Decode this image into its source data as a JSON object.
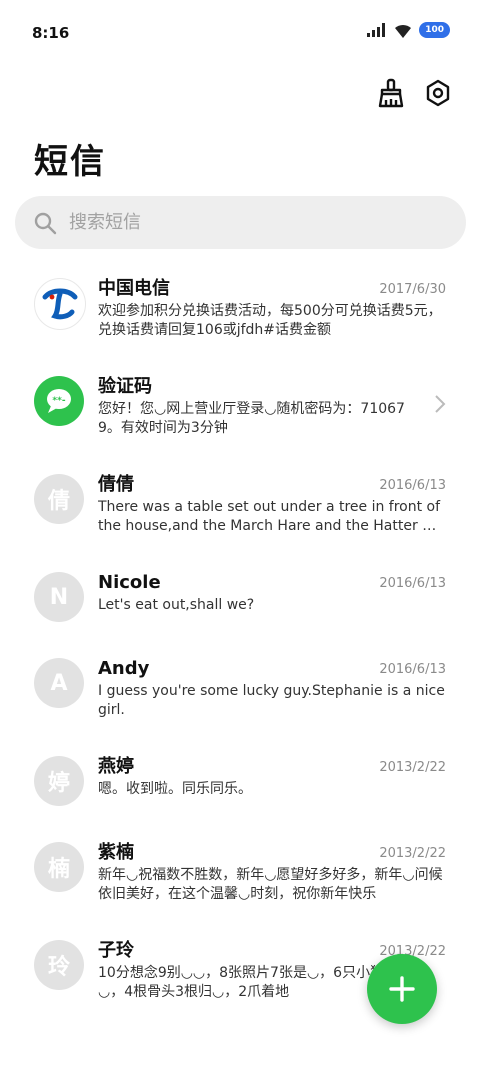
{
  "status": {
    "time": "8:16",
    "battery": "100"
  },
  "header": {
    "title": "短信"
  },
  "search": {
    "placeholder": "搜索短信"
  },
  "colors": {
    "accent": "#2ec24d",
    "battery": "#2f6fe8",
    "avatar_default": "#e2e2e2"
  },
  "conversations": [
    {
      "name": "中国电信",
      "date": "2017/6/30",
      "avatar": "china-telecom-logo",
      "preview": "欢迎参加积分兑换话费活动，每500分可兑换话费5元，兑换话费请回复106或jfdh#话费金额"
    },
    {
      "name": "验证码",
      "date": "",
      "avatar": "message-icon",
      "preview": "您好！您◡网上营业厅登录◡随机密码为：710679。有效时间为3分钟"
    },
    {
      "name": "倩倩",
      "date": "2016/6/13",
      "avatar": "倩",
      "preview": "There was a table set out under a tree in front of the house,and the March Hare and the Hatter were having tea at it"
    },
    {
      "name": "Nicole",
      "date": "2016/6/13",
      "avatar": "N",
      "preview": "Let's eat out,shall we?"
    },
    {
      "name": "Andy",
      "date": "2016/6/13",
      "avatar": "A",
      "preview": "I guess you're some lucky guy.Stephanie is a nice girl."
    },
    {
      "name": "燕婷",
      "date": "2013/2/22",
      "avatar": "婷",
      "preview": "嗯。收到啦。同乐同乐。"
    },
    {
      "name": "紫楠",
      "date": "2013/2/22",
      "avatar": "楠",
      "preview": "新年◡祝福数不胜数，新年◡愿望好多好多，新年◡问候依旧美好，在这个温馨◡时刻，祝你新年快乐"
    },
    {
      "name": "子玲",
      "date": "2013/2/22",
      "avatar": "玲",
      "preview": "10分想念9别◡◡，8张照片7张是◡，6只小狗5只像◡，4根骨头3根归◡，2爪着地"
    }
  ]
}
